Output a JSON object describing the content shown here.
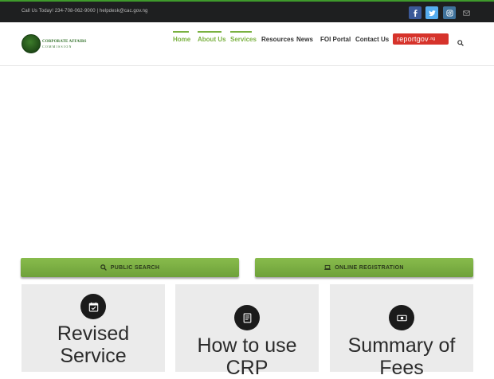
{
  "topbar": {
    "contact": "Call Us Today! 234-708-062-9000  |  helpdesk@cac.gov.ng"
  },
  "logo": {
    "line1": "CORPORATE AFFAIRS",
    "line2": "COMMISSION"
  },
  "nav": {
    "items": [
      {
        "label": "Home"
      },
      {
        "label": "About Us"
      },
      {
        "label": "Services"
      },
      {
        "label": "Resources"
      },
      {
        "label": "News"
      },
      {
        "label": "FOI Portal"
      },
      {
        "label": "Contact Us"
      }
    ],
    "report_label": "reportgov",
    "report_suffix": ".ng"
  },
  "actions": {
    "public_search": "PUBLIC SEARCH",
    "online_registration": "ONLINE REGISTRATION"
  },
  "cards": [
    {
      "title_line1": "Revised",
      "title_line2": "Service"
    },
    {
      "title_line1": "How to use",
      "title_line2": "CRP"
    },
    {
      "title_line1": "Summary of",
      "title_line2": "Fees"
    }
  ],
  "colors": {
    "accent_green": "#7ab140",
    "topbar_bg": "#1e1f20",
    "report_red": "#d6332b"
  },
  "icons": {
    "social": [
      "facebook-icon",
      "twitter-icon",
      "instagram-icon",
      "mail-icon"
    ],
    "cards": [
      "calendar-check-icon",
      "document-icon",
      "money-icon"
    ]
  }
}
